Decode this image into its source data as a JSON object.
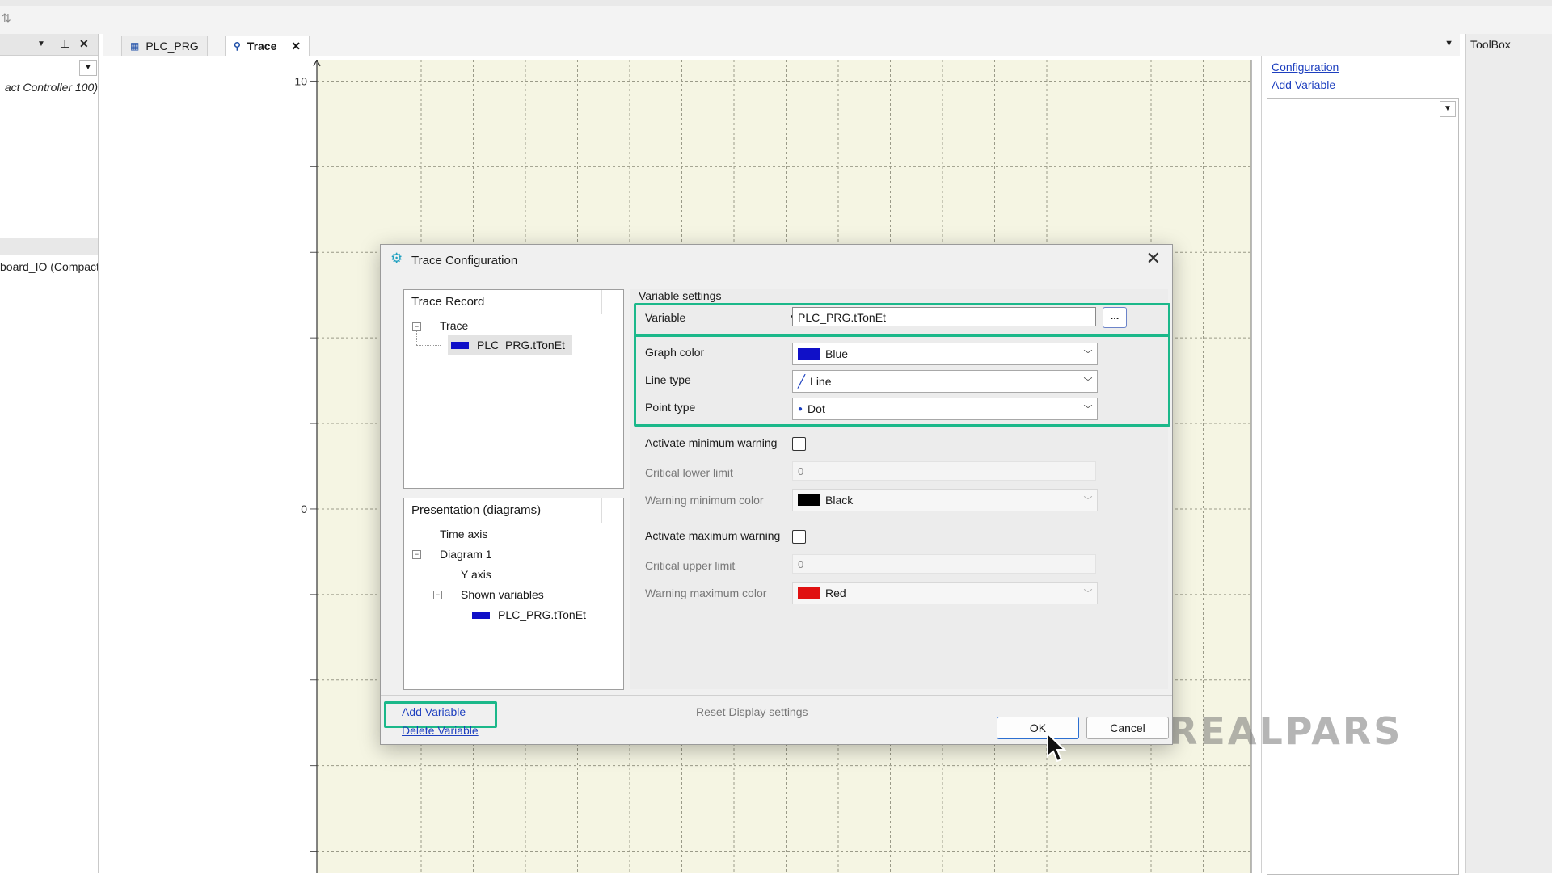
{
  "left_panel": {
    "item1": "act Controller 100)",
    "item2": "board_IO (Compact"
  },
  "tabs": [
    {
      "label": "PLC_PRG"
    },
    {
      "label": "Trace"
    }
  ],
  "chart_data": {
    "type": "line",
    "title": "",
    "xlabel": "",
    "ylabel": "",
    "y_tick_labels": [
      "10",
      "0"
    ],
    "ylim": [
      -8.5,
      10.5
    ],
    "grid": true,
    "series": []
  },
  "right_panel": {
    "links": [
      "Configuration",
      "Add Variable"
    ]
  },
  "toolbox": {
    "title": "ToolBox"
  },
  "dialog": {
    "title": "Trace Configuration",
    "trace_record": {
      "header": "Trace Record",
      "root": "Trace",
      "variable": "PLC_PRG.tTonEt"
    },
    "presentation": {
      "header": "Presentation (diagrams)",
      "time_axis": "Time axis",
      "diagram": "Diagram 1",
      "y_axis": "Y axis",
      "shown_variables": "Shown variables",
      "variable": "PLC_PRG.tTonEt"
    },
    "settings": {
      "section_label": "Variable settings",
      "variable_kind": "Variable",
      "variable_value": "PLC_PRG.tTonEt",
      "browse_label": "...",
      "graph_color_label": "Graph color",
      "graph_color_value": "Blue",
      "line_type_label": "Line type",
      "line_type_value": "Line",
      "point_type_label": "Point type",
      "point_type_value": "Dot",
      "min_warning_label": "Activate minimum warning",
      "critical_lower_label": "Critical lower limit",
      "critical_lower_value": "0",
      "warn_min_color_label": "Warning minimum color",
      "warn_min_color_value": "Black",
      "max_warning_label": "Activate maximum warning",
      "critical_upper_label": "Critical upper limit",
      "critical_upper_value": "0",
      "warn_max_color_label": "Warning maximum color",
      "warn_max_color_value": "Red"
    },
    "add_variable": "Add Variable",
    "delete_variable": "Delete Variable",
    "reset_display": "Reset Display settings",
    "ok": "OK",
    "cancel": "Cancel"
  },
  "colors": {
    "highlight": "#1bb88a",
    "graph_blue": "#1010c8",
    "warn_black": "#000000",
    "warn_red": "#e01010",
    "plot_bg": "#f5f5e3"
  },
  "watermark": "REALPARS"
}
